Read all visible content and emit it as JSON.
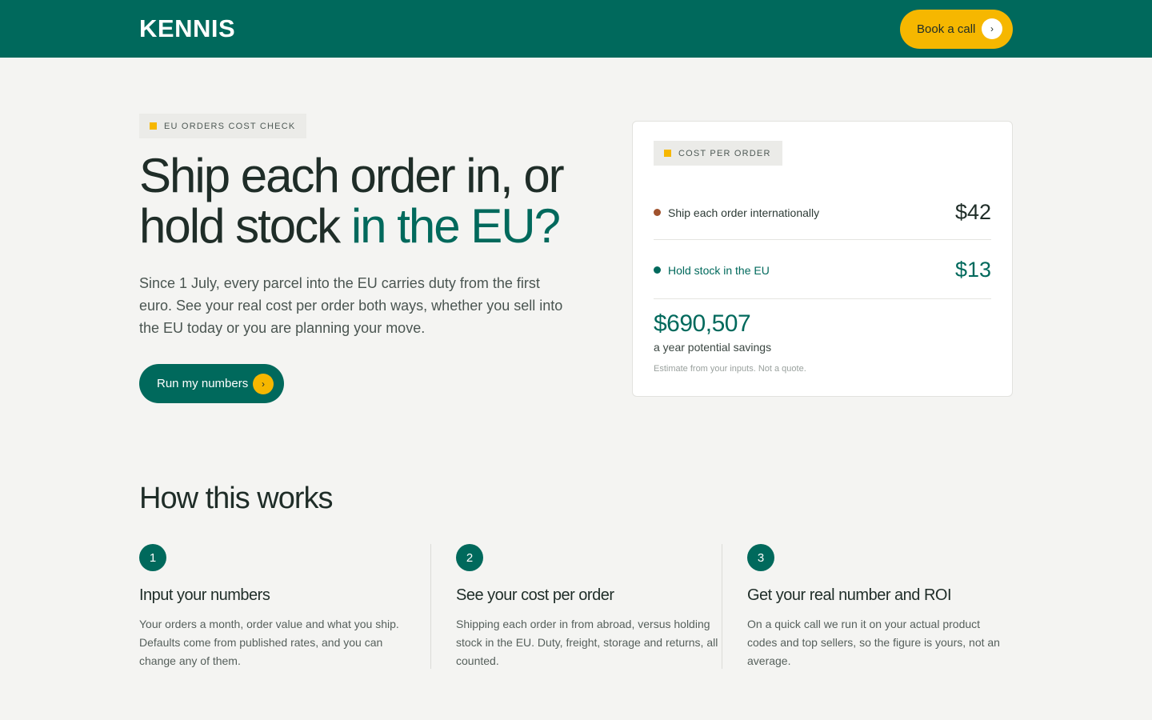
{
  "header": {
    "logo": "KENNIS",
    "cta_label": "Book a call",
    "cta_arrow": "›"
  },
  "hero": {
    "badge": "EU ORDERS COST CHECK",
    "title_part1": "Ship each order in, or hold stock ",
    "title_accent": "in the EU?",
    "description": "Since 1 July, every parcel into the EU carries duty from the first euro. See your real cost per order both ways, whether you sell into the EU today or you are planning your move.",
    "cta_label": "Run my numbers",
    "cta_arrow": "›"
  },
  "card": {
    "badge": "COST PER ORDER",
    "rows": [
      {
        "label": "Ship each order internationally",
        "value": "$42",
        "dot_color": "#a0522d"
      },
      {
        "label": "Hold stock in the EU",
        "value": "$13",
        "dot_color": "#00695c"
      }
    ],
    "savings_value": "$690,507",
    "savings_label": "a year potential savings",
    "fineprint": "Estimate from your inputs. Not a quote."
  },
  "how": {
    "title": "How this works",
    "steps": [
      {
        "num": "1",
        "title": "Input your numbers",
        "text": "Your orders a month, order value and what you ship. Defaults come from published rates, and you can change any of them."
      },
      {
        "num": "2",
        "title": "See your cost per order",
        "text": "Shipping each order in from abroad, versus holding stock in the EU. Duty, freight, storage and returns, all counted."
      },
      {
        "num": "3",
        "title": "Get your real number and ROI",
        "text": "On a quick call we run it on your actual product codes and top sellers, so the figure is yours, not an average."
      }
    ]
  },
  "colors": {
    "brand": "#00695c",
    "accent": "#f6b700",
    "background": "#f4f4f2"
  }
}
